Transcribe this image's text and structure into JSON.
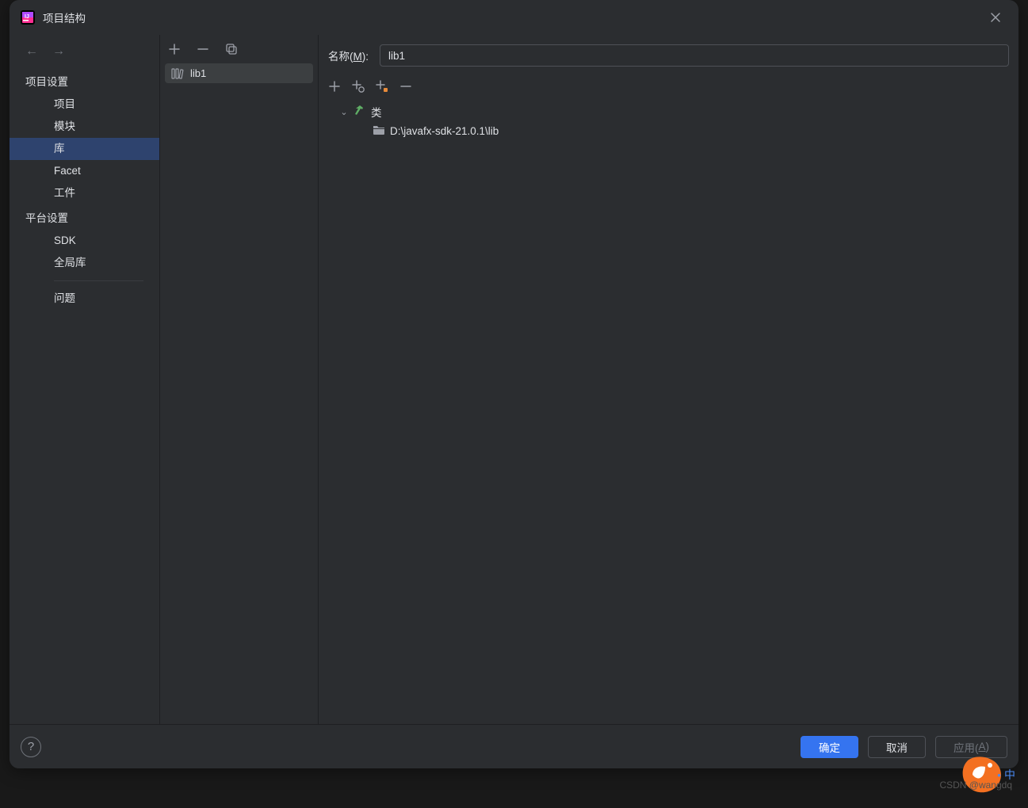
{
  "window": {
    "title": "项目结构"
  },
  "sidebar": {
    "sections": {
      "project_settings": {
        "header": "项目设置",
        "items": [
          "项目",
          "模块",
          "库",
          "Facet",
          "工件"
        ]
      },
      "platform_settings": {
        "header": "平台设置",
        "items": [
          "SDK",
          "全局库"
        ]
      },
      "problems": {
        "items": [
          "问题"
        ]
      }
    },
    "selected": "库"
  },
  "library_list": {
    "items": [
      {
        "name": "lib1"
      }
    ],
    "selected": "lib1"
  },
  "details": {
    "name_label_prefix": "名称(",
    "name_label_mnemonic": "M",
    "name_label_suffix": "):",
    "name_value": "lib1",
    "tree": {
      "classes_label": "类",
      "entries": [
        {
          "path": "D:\\javafx-sdk-21.0.1\\lib"
        }
      ]
    }
  },
  "buttons": {
    "ok": "确定",
    "cancel": "取消",
    "apply_prefix": "应用(",
    "apply_mnemonic": "A",
    "apply_suffix": ")"
  },
  "watermark": "CSDN @wangdq",
  "ime": "中"
}
